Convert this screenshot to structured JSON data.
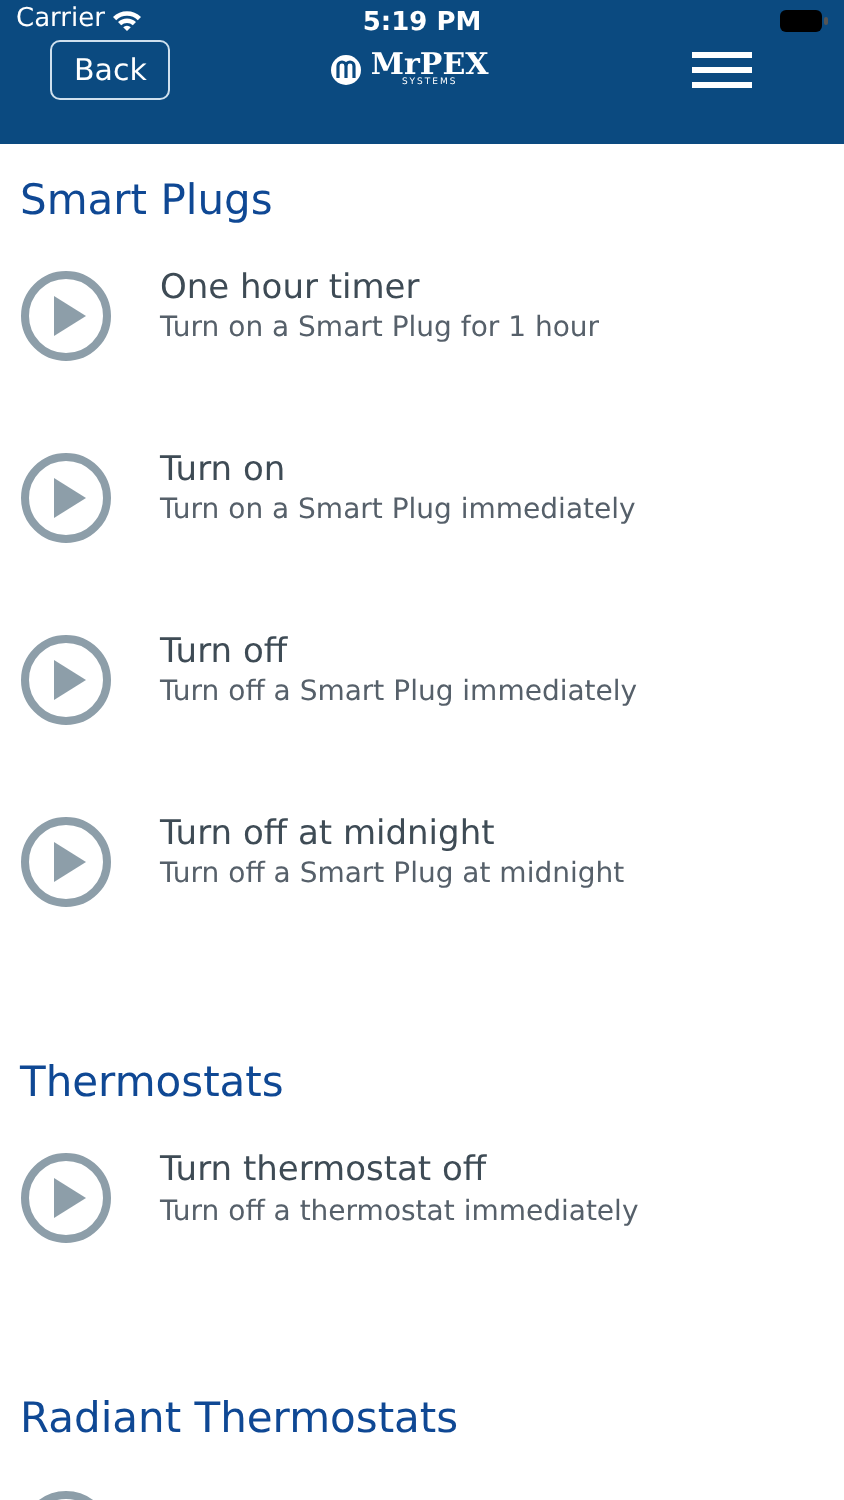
{
  "status_bar": {
    "carrier": "Carrier",
    "time": "5:19 PM"
  },
  "nav": {
    "back": "Back",
    "logo": "MrPEX",
    "logo_sub": "SYSTEMS"
  },
  "sections": [
    {
      "title": "Smart Plugs",
      "items": [
        {
          "kind": "action",
          "title": "One hour timer",
          "subtitle": "Turn on a Smart Plug for 1 hour"
        },
        {
          "kind": "action",
          "title": "Turn on",
          "subtitle": "Turn on a Smart Plug immediately"
        },
        {
          "kind": "action",
          "title": "Turn off",
          "subtitle": "Turn off a Smart Plug immediately"
        },
        {
          "kind": "action",
          "title": "Turn off at midnight",
          "subtitle": "Turn off a Smart Plug at midnight"
        }
      ]
    },
    {
      "title": "Thermostats",
      "items": [
        {
          "kind": "action",
          "title": "Turn thermostat off",
          "subtitle": "Turn off a thermostat immediately"
        }
      ]
    },
    {
      "title": "Radiant Thermostats",
      "items": [
        {
          "kind": "cut_off"
        }
      ]
    }
  ]
}
